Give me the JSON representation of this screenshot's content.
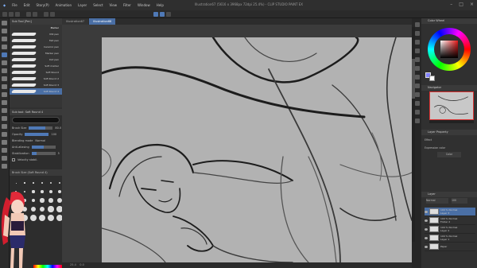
{
  "app": {
    "window_title": "Illustration67 (5616 x 3968px 72dpi 25.4%) - CLIP STUDIO PAINT EX"
  },
  "menu": [
    "File",
    "Edit",
    "Story(P)",
    "Animation",
    "Layer",
    "Select",
    "View",
    "Filter",
    "Window",
    "Help"
  ],
  "window_controls": [
    "–",
    "□",
    "×"
  ],
  "left_panel": {
    "tab_label": "Sub Tool [Pen]",
    "brush_header": "Marker",
    "brushes": [
      "Mill pen",
      "Felt pen",
      "Ceramic pen",
      "Marker pen",
      "Dot pen",
      "Soft marker",
      "Soft Round",
      "Soft Round 2",
      "Soft Round 3",
      "Soft Round 4"
    ],
    "selected_brush_index": 9,
    "tool_property_title": "Sub tool: Soft Round 4",
    "properties": [
      {
        "label": "Brush Size",
        "value": "80.0",
        "fill": 0.7
      },
      {
        "label": "Opacity",
        "value": "100",
        "fill": 1.0
      },
      {
        "label": "Blending mode",
        "value": "Normal",
        "fill": 0
      },
      {
        "label": "Anti-aliasing",
        "value": "",
        "fill": 0.5
      },
      {
        "label": "Stabilization",
        "value": "5",
        "fill": 0.2
      }
    ],
    "velocity_label": "Velocity stabil.",
    "brush_size_header": "Brush Size (Soft Round 4)",
    "sizes": [
      "0.7",
      "1",
      "1.5",
      "2",
      "2.5",
      "3",
      "4",
      "5",
      "6",
      "7",
      "8",
      "10",
      "12",
      "15",
      "17",
      "20",
      "25",
      "30",
      "40",
      "50",
      "60",
      "70",
      "80",
      "100",
      "120",
      "150",
      "170",
      "200",
      "250",
      "300"
    ]
  },
  "doc_tabs": [
    "Illustration67",
    "Illustration68"
  ],
  "status": {
    "zoom": "25.4",
    "angle": "0.0"
  },
  "right_panel": {
    "color_tab": "Color Wheel",
    "navigator_tab": "Navigator",
    "layer_property_tab": "Layer Property",
    "effect_label": "Effect",
    "expression_label": "Expression color",
    "expression_value": "Color",
    "layer_tab": "Layer",
    "blend_mode": "Normal",
    "opacity": "100",
    "layers": [
      {
        "name": "100 % Normal",
        "sub": "Layer 3",
        "selected": true
      },
      {
        "name": "100 % Normal",
        "sub": "Folder 2",
        "selected": false
      },
      {
        "name": "100 % Normal",
        "sub": "Layer 2",
        "selected": false
      },
      {
        "name": "100 % Normal",
        "sub": "Layer 1",
        "selected": false
      },
      {
        "name": "Paper",
        "sub": "",
        "selected": false
      }
    ]
  },
  "colors": {
    "accent": "#4a6fa5",
    "main_color": "#8080ff",
    "sub_color": "#ffffff"
  }
}
